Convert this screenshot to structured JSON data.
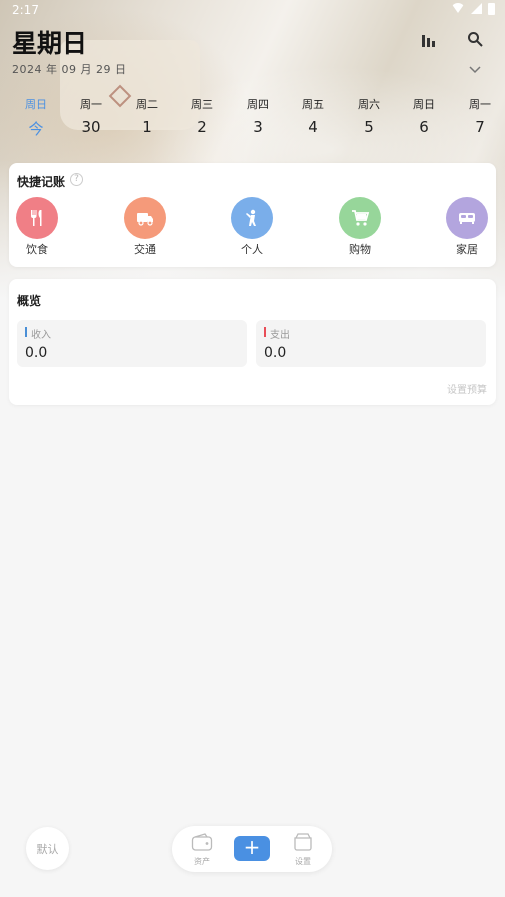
{
  "status_bar": {
    "time": "2:17"
  },
  "header": {
    "title": "星期日",
    "date": "2024 年 09 月 29 日",
    "icons": [
      "bar-chart-icon",
      "search-icon",
      "chevron-down-icon"
    ]
  },
  "week": [
    {
      "name": "周日",
      "num": "今",
      "active": true
    },
    {
      "name": "周一",
      "num": "30",
      "active": false
    },
    {
      "name": "周二",
      "num": "1",
      "active": false
    },
    {
      "name": "周三",
      "num": "2",
      "active": false
    },
    {
      "name": "周四",
      "num": "3",
      "active": false
    },
    {
      "name": "周五",
      "num": "4",
      "active": false
    },
    {
      "name": "周六",
      "num": "5",
      "active": false
    },
    {
      "name": "周日",
      "num": "6",
      "active": false
    },
    {
      "name": "周一",
      "num": "7",
      "active": false
    }
  ],
  "quick": {
    "title": "快捷记账",
    "help": "?",
    "items": [
      {
        "label": "饮食",
        "icon": "fork-knife-icon",
        "color": "#f07f86"
      },
      {
        "label": "交通",
        "icon": "truck-icon",
        "color": "#f59a7a"
      },
      {
        "label": "个人",
        "icon": "person-icon",
        "color": "#7aaeea"
      },
      {
        "label": "购物",
        "icon": "cart-icon",
        "color": "#97d69a"
      },
      {
        "label": "家居",
        "icon": "bed-icon",
        "color": "#b3a5de"
      }
    ]
  },
  "overview": {
    "title": "概览",
    "income_label": "收入",
    "income_value": "0.0",
    "expense_label": "支出",
    "expense_value": "0.0",
    "budget_link": "设置预算"
  },
  "bottom": {
    "default_label": "默认",
    "assets_label": "资产",
    "add_label": "+",
    "settings_label": "设置"
  }
}
